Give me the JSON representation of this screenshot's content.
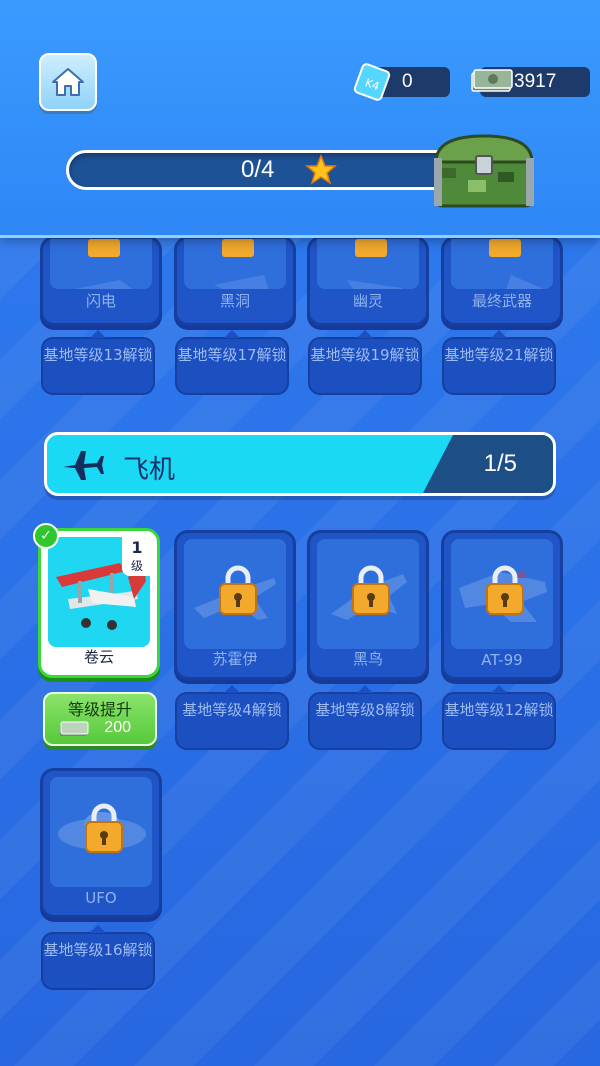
{
  "currency": {
    "gems": "0",
    "cash": "3917"
  },
  "progress": {
    "text": "0/4"
  },
  "top_row": [
    {
      "name": "闪电",
      "unlock": "基地等级13解锁"
    },
    {
      "name": "黑洞",
      "unlock": "基地等级17解锁"
    },
    {
      "name": "幽灵",
      "unlock": "基地等级19解锁"
    },
    {
      "name": "最终武器",
      "unlock": "基地等级21解锁"
    }
  ],
  "section": {
    "title": "飞机",
    "count": "1/5"
  },
  "planes": [
    {
      "name": "卷云",
      "level_num": "1",
      "level_unit": "级"
    },
    {
      "name": "苏霍伊",
      "unlock": "基地等级4解锁"
    },
    {
      "name": "黑鸟",
      "unlock": "基地等级8解锁"
    },
    {
      "name": "AT-99",
      "unlock": "基地等级12解锁"
    },
    {
      "name": "UFO",
      "unlock": "基地等级16解锁"
    }
  ],
  "upgrade": {
    "label": "等级提升",
    "cost": "200"
  },
  "colors": {
    "accent_cyan": "#1ad9f5",
    "selected_green": "#3bd83b",
    "bg_blue": "#2a6ee6"
  }
}
